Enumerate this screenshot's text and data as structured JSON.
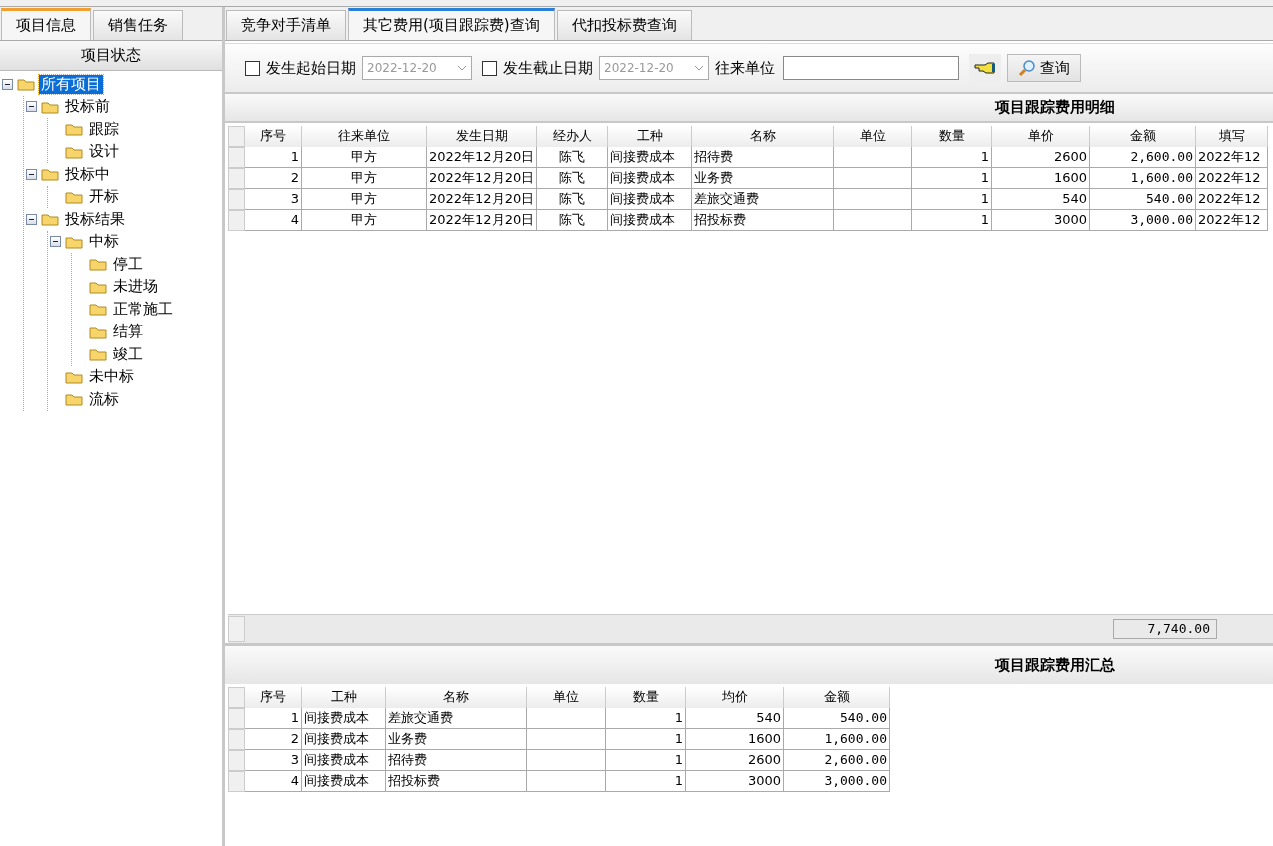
{
  "left_tabs": [
    {
      "label": "项目信息",
      "selected": true
    },
    {
      "label": "销售任务",
      "selected": false
    }
  ],
  "right_tabs": [
    {
      "label": "竞争对手清单",
      "selected": false
    },
    {
      "label": "其它费用(项目跟踪费)查询",
      "selected": true
    },
    {
      "label": "代扣投标费查询",
      "selected": false
    }
  ],
  "sidebar": {
    "title": "项目状态",
    "tree": [
      {
        "label": "所有项目",
        "selected": true,
        "expanded": true,
        "children": [
          {
            "label": "投标前",
            "selected": false,
            "expanded": true,
            "children": [
              {
                "label": "跟踪",
                "selected": false
              },
              {
                "label": "设计",
                "selected": false
              }
            ]
          },
          {
            "label": "投标中",
            "selected": false,
            "expanded": true,
            "children": [
              {
                "label": "开标",
                "selected": false
              }
            ]
          },
          {
            "label": "投标结果",
            "selected": false,
            "expanded": true,
            "children": [
              {
                "label": "中标",
                "selected": false,
                "expanded": true,
                "children": [
                  {
                    "label": "停工",
                    "selected": false
                  },
                  {
                    "label": "未进场",
                    "selected": false
                  },
                  {
                    "label": "正常施工",
                    "selected": false
                  },
                  {
                    "label": "结算",
                    "selected": false
                  },
                  {
                    "label": "竣工",
                    "selected": false
                  }
                ]
              },
              {
                "label": "未中标",
                "selected": false
              },
              {
                "label": "流标",
                "selected": false
              }
            ]
          }
        ]
      }
    ]
  },
  "filters": {
    "start_date": {
      "label": "发生起始日期",
      "checked": false,
      "value": "2022-12-20"
    },
    "end_date": {
      "label": "发生截止日期",
      "checked": false,
      "value": "2022-12-20"
    },
    "partner": {
      "label": "往来单位"
    },
    "query_button": "查询"
  },
  "detail": {
    "title": "项目跟踪费用明细",
    "columns": [
      "序号",
      "往来单位",
      "发生日期",
      "经办人",
      "工种",
      "名称",
      "单位",
      "数量",
      "单价",
      "金额",
      "填写"
    ],
    "rows": [
      [
        "1",
        "甲方",
        "2022年12月20日",
        "陈飞",
        "间接费成本",
        "招待费",
        "",
        "1",
        "2600",
        "2,600.00",
        "2022年12"
      ],
      [
        "2",
        "甲方",
        "2022年12月20日",
        "陈飞",
        "间接费成本",
        "业务费",
        "",
        "1",
        "1600",
        "1,600.00",
        "2022年12"
      ],
      [
        "3",
        "甲方",
        "2022年12月20日",
        "陈飞",
        "间接费成本",
        "差旅交通费",
        "",
        "1",
        "540",
        "540.00",
        "2022年12"
      ],
      [
        "4",
        "甲方",
        "2022年12月20日",
        "陈飞",
        "间接费成本",
        "招投标费",
        "",
        "1",
        "3000",
        "3,000.00",
        "2022年12"
      ]
    ],
    "total": "7,740.00"
  },
  "summary": {
    "title": "项目跟踪费用汇总",
    "columns": [
      "序号",
      "工种",
      "名称",
      "单位",
      "数量",
      "均价",
      "金额"
    ],
    "rows": [
      [
        "1",
        "间接费成本",
        "差旅交通费",
        "",
        "1",
        "540",
        "540.00"
      ],
      [
        "2",
        "间接费成本",
        "业务费",
        "",
        "1",
        "1600",
        "1,600.00"
      ],
      [
        "3",
        "间接费成本",
        "招待费",
        "",
        "1",
        "2600",
        "2,600.00"
      ],
      [
        "4",
        "间接费成本",
        "招投标费",
        "",
        "1",
        "3000",
        "3,000.00"
      ]
    ]
  }
}
